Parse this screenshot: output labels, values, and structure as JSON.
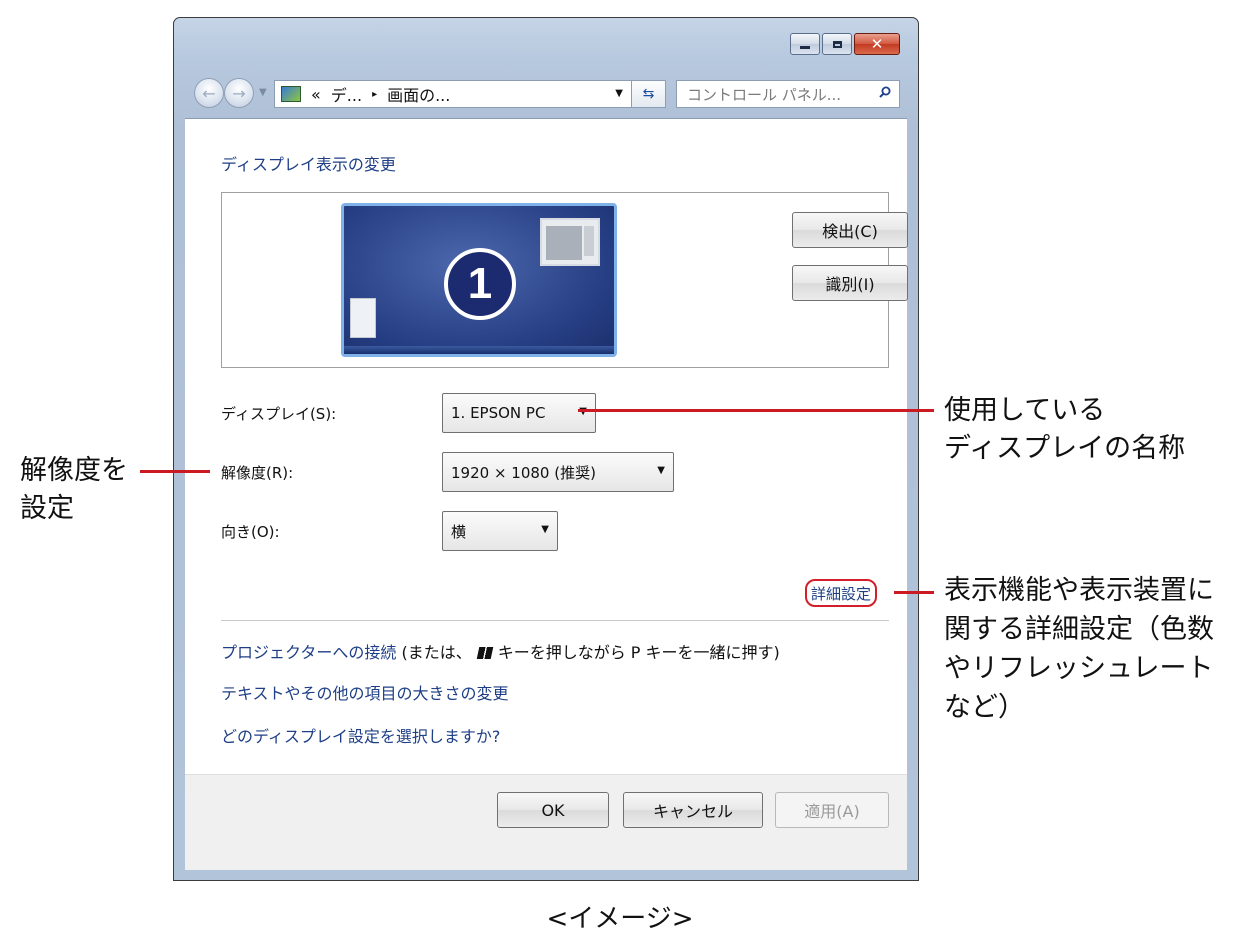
{
  "window": {
    "buttons": {
      "minimize": "–",
      "maximize": "□",
      "close": "✕"
    }
  },
  "navbar": {
    "back_icon": "back-arrow-icon",
    "forward_icon": "forward-arrow-icon",
    "address": {
      "prefix": "«",
      "seg1": "デ...",
      "arrow": "▸",
      "seg2": "画面の...",
      "dropdown": "▼"
    },
    "refresh": "⁴+",
    "search_placeholder": "コントロール パネル..."
  },
  "main": {
    "heading": "ディスプレイ表示の変更",
    "monitor_number": "1",
    "detect_button": "検出(C)",
    "identify_button": "識別(I)",
    "display_label": "ディスプレイ(S):",
    "display_value": "1. EPSON PC",
    "resolution_label": "解像度(R):",
    "resolution_value": "1920 × 1080 (推奨)",
    "orientation_label": "向き(O):",
    "orientation_value": "横",
    "advanced_link": "詳細設定",
    "links": {
      "projector": "プロジェクターへの接続",
      "projector_note_pre": "(または、",
      "projector_note_post": "キーを押しながら P キーを一緒に押す)",
      "text_size": "テキストやその他の項目の大きさの変更",
      "which_setting": "どのディスプレイ設定を選択しますか?"
    },
    "ok_button": "OK",
    "cancel_button": "キャンセル",
    "apply_button": "適用(A)"
  },
  "annotations": {
    "resolution_line1": "解像度を",
    "resolution_line2": "設定",
    "display_line1": "使用している",
    "display_line2": "ディスプレイの名称",
    "advanced_line1": "表示機能や表示装置に",
    "advanced_line2": "関する詳細設定（色数",
    "advanced_line3": "やリフレッシュレート",
    "advanced_line4": "など）",
    "line_color": "#cc1a22"
  },
  "caption": "<イメージ>"
}
